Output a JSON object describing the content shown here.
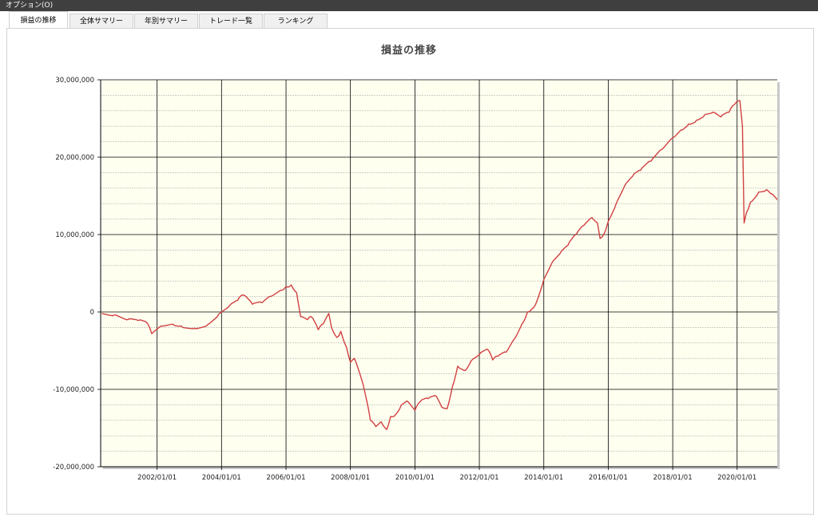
{
  "menubar": {
    "options_label": "オプション(O)"
  },
  "tabs": [
    {
      "label": "損益の推移",
      "active": true
    },
    {
      "label": "全体サマリー",
      "active": false
    },
    {
      "label": "年別サマリー",
      "active": false
    },
    {
      "label": "トレード一覧",
      "active": false
    },
    {
      "label": "ランキング",
      "active": false
    }
  ],
  "colors": {
    "line": "#d04040",
    "plot_bg": "#fffff0",
    "major_grid": "#000000",
    "minor_grid": "#b0b0b0"
  },
  "chart_data": {
    "type": "line",
    "title": "損益の推移",
    "xlabel": "",
    "ylabel": "",
    "grid": true,
    "xlim": [
      "2000-04-01",
      "2021-03-31"
    ],
    "ylim": [
      -20000000,
      30000000
    ],
    "y_ticks": [
      {
        "value": 30000000,
        "label": "30,000,000"
      },
      {
        "value": 20000000,
        "label": "20,000,000"
      },
      {
        "value": 10000000,
        "label": "10,000,000"
      },
      {
        "value": 0,
        "label": "0"
      },
      {
        "value": -10000000,
        "label": "-10,000,000"
      },
      {
        "value": -20000000,
        "label": "-20,000,000"
      }
    ],
    "x_ticks": [
      {
        "value": "2002-01-01",
        "label": "2002/01/01"
      },
      {
        "value": "2004-01-01",
        "label": "2004/01/01"
      },
      {
        "value": "2006-01-01",
        "label": "2006/01/01"
      },
      {
        "value": "2008-01-01",
        "label": "2008/01/01"
      },
      {
        "value": "2010-01-01",
        "label": "2010/01/01"
      },
      {
        "value": "2012-01-01",
        "label": "2012/01/01"
      },
      {
        "value": "2014-01-01",
        "label": "2014/01/01"
      },
      {
        "value": "2016-01-01",
        "label": "2016/01/01"
      },
      {
        "value": "2018-01-01",
        "label": "2018/01/01"
      },
      {
        "value": "2020-01-01",
        "label": "2020/01/01"
      }
    ],
    "series": [
      {
        "x": [
          "2000-04-15",
          "2000-09-01",
          "2001-02-01",
          "2001-06-01",
          "2001-09-15",
          "2001-11-01",
          "2002-03-01",
          "2002-07-01",
          "2002-10-01",
          "2003-03-01",
          "2003-08-01",
          "2003-12-01",
          "2004-04-01",
          "2004-07-01",
          "2004-09-01",
          "2004-12-15",
          "2005-04-01",
          "2005-07-01",
          "2005-11-01",
          "2006-01-01",
          "2006-03-01",
          "2006-05-01",
          "2006-06-15",
          "2006-09-01",
          "2006-10-15",
          "2007-01-01",
          "2007-03-01",
          "2007-05-01",
          "2007-06-01",
          "2007-08-01",
          "2007-09-15",
          "2007-11-15",
          "2008-01-01",
          "2008-02-15",
          "2008-05-01",
          "2008-06-15",
          "2008-08-15",
          "2008-10-15",
          "2008-12-15",
          "2009-02-15",
          "2009-04-01",
          "2009-06-01",
          "2009-08-01",
          "2009-10-01",
          "2010-01-01",
          "2010-03-01",
          "2010-06-01",
          "2010-09-01",
          "2010-11-01",
          "2011-01-01",
          "2011-03-01",
          "2011-05-01",
          "2011-08-01",
          "2011-10-01",
          "2012-01-01",
          "2012-04-01",
          "2012-06-01",
          "2012-08-01",
          "2012-11-01",
          "2013-02-01",
          "2013-05-01",
          "2013-07-01",
          "2013-10-01",
          "2014-01-01",
          "2014-04-01",
          "2014-07-01",
          "2014-10-01",
          "2015-01-01",
          "2015-04-01",
          "2015-07-01",
          "2015-09-01",
          "2015-10-01",
          "2015-12-01",
          "2016-01-01",
          "2016-04-01",
          "2016-07-01",
          "2016-10-01",
          "2017-01-01",
          "2017-05-01",
          "2017-09-01",
          "2018-01-01",
          "2018-04-01",
          "2018-07-01",
          "2018-10-01",
          "2019-01-01",
          "2019-04-01",
          "2019-07-01",
          "2019-10-01",
          "2019-12-01",
          "2020-02-01",
          "2020-03-01",
          "2020-03-20",
          "2020-04-15",
          "2020-06-01",
          "2020-09-01",
          "2020-12-01",
          "2021-01-15",
          "2021-03-31"
        ],
        "y": [
          -200000,
          -400000,
          -1000000,
          -1100000,
          -1500000,
          -2800000,
          -1800000,
          -1600000,
          -1800000,
          -2100000,
          -1600000,
          -300000,
          800000,
          1500000,
          2200000,
          1000000,
          1200000,
          2000000,
          2800000,
          3300000,
          3500000,
          2500000,
          -600000,
          -1000000,
          -600000,
          -2300000,
          -1500000,
          -200000,
          -2000000,
          -3300000,
          -2500000,
          -4500000,
          -6500000,
          -6000000,
          -8500000,
          -10500000,
          -14000000,
          -14800000,
          -14200000,
          -15200000,
          -13500000,
          -13200000,
          -12000000,
          -11500000,
          -12700000,
          -11600000,
          -11200000,
          -10900000,
          -12300000,
          -12500000,
          -9700000,
          -7000000,
          -7500000,
          -6300000,
          -5500000,
          -4800000,
          -6200000,
          -5700000,
          -5200000,
          -3500000,
          -1500000,
          0,
          1000000,
          4200000,
          6300000,
          7500000,
          8600000,
          10000000,
          11200000,
          12200000,
          11500000,
          9500000,
          10500000,
          11700000,
          14000000,
          16200000,
          17500000,
          18300000,
          19500000,
          21000000,
          22500000,
          23500000,
          24300000,
          24800000,
          25500000,
          25800000,
          25200000,
          25800000,
          26800000,
          27300000,
          24000000,
          11500000,
          12800000,
          14200000,
          15500000,
          15800000,
          15300000,
          14500000
        ]
      }
    ]
  }
}
